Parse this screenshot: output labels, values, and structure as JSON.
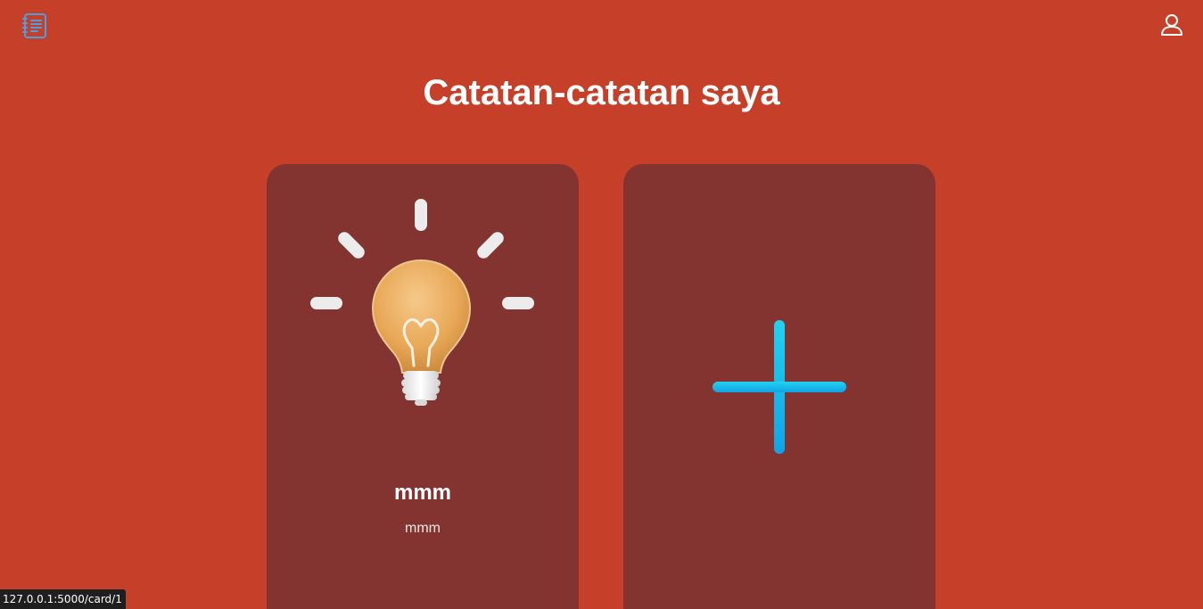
{
  "header": {
    "logo_icon": "notebook-icon",
    "profile_icon": "user-icon"
  },
  "page_title": "Catatan-catatan saya",
  "cards": [
    {
      "icon": "lightbulb-icon",
      "title": "mmm",
      "description": "mmm"
    }
  ],
  "add_card": {
    "icon": "plus-icon"
  },
  "status_bar": {
    "url": "127.0.0.1:5000/card/1"
  },
  "colors": {
    "background": "#c63f28",
    "card": "#833430",
    "accent": "#1ab5e8",
    "text": "#ffffff"
  }
}
